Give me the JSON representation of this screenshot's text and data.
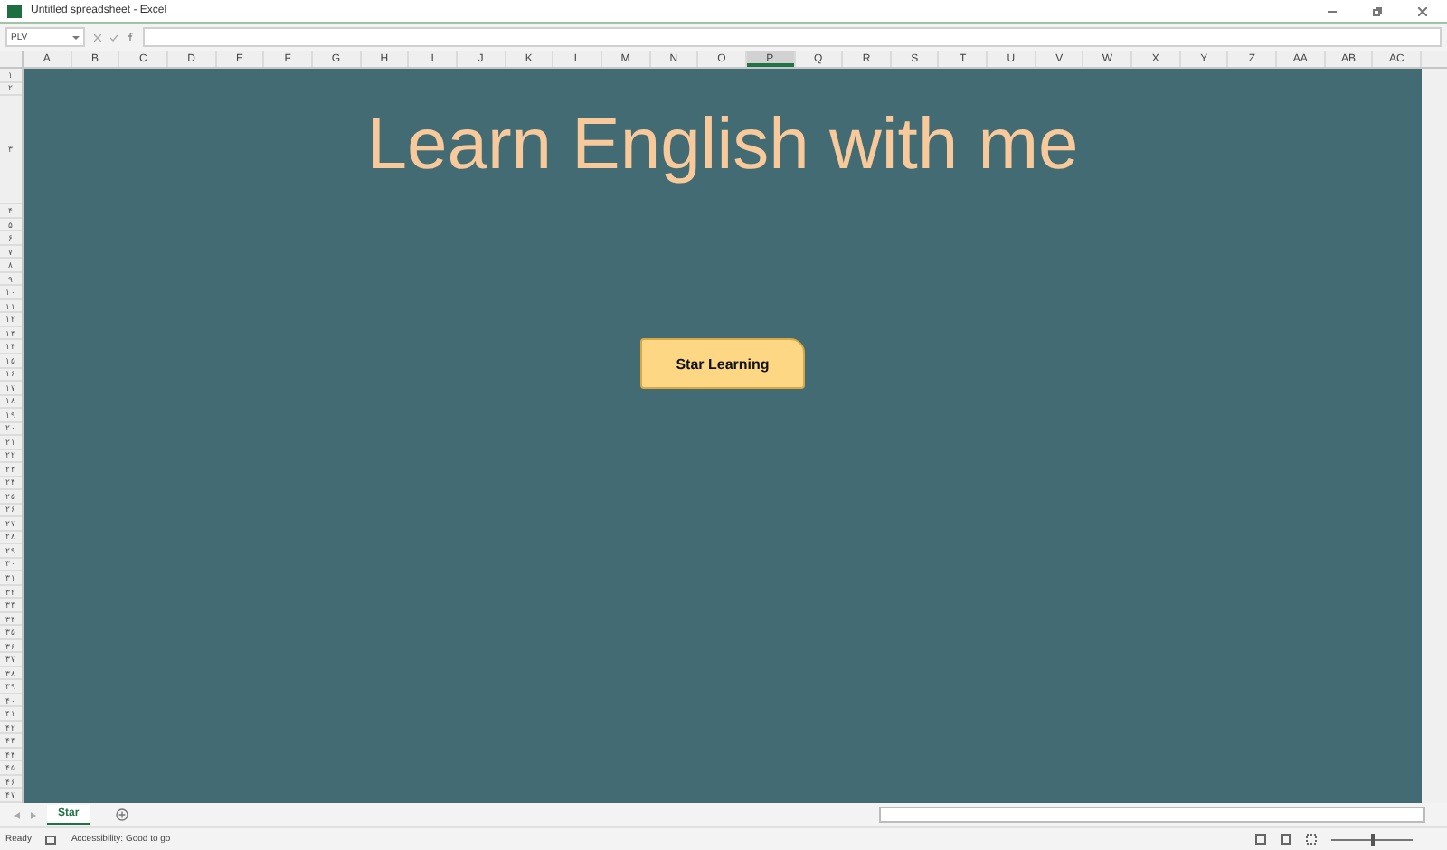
{
  "window": {
    "title": "Untitled spreadsheet - Excel"
  },
  "formula_bar": {
    "name_box": "PLV"
  },
  "columns": [
    {
      "label": "A",
      "selected": false
    },
    {
      "label": "B",
      "selected": false
    },
    {
      "label": "C",
      "selected": false
    },
    {
      "label": "D",
      "selected": false
    },
    {
      "label": "E",
      "selected": false
    },
    {
      "label": "F",
      "selected": false
    },
    {
      "label": "G",
      "selected": false
    },
    {
      "label": "H",
      "selected": false
    },
    {
      "label": "I",
      "selected": false
    },
    {
      "label": "J",
      "selected": false
    },
    {
      "label": "K",
      "selected": false
    },
    {
      "label": "L",
      "selected": false
    },
    {
      "label": "M",
      "selected": false
    },
    {
      "label": "N",
      "selected": false
    },
    {
      "label": "O",
      "selected": false
    },
    {
      "label": "P",
      "selected": true
    },
    {
      "label": "Q",
      "selected": false
    },
    {
      "label": "R",
      "selected": false
    },
    {
      "label": "S",
      "selected": false
    },
    {
      "label": "T",
      "selected": false
    },
    {
      "label": "U",
      "selected": false
    },
    {
      "label": "V",
      "selected": false
    },
    {
      "label": "W",
      "selected": false
    },
    {
      "label": "X",
      "selected": false
    },
    {
      "label": "Y",
      "selected": false
    },
    {
      "label": "Z",
      "selected": false
    },
    {
      "label": "AA",
      "selected": false
    },
    {
      "label": "AB",
      "selected": false
    },
    {
      "label": "AC",
      "selected": false
    }
  ],
  "rows": [
    "۱",
    "۲",
    "۳",
    "۴",
    "۵",
    "۶",
    "۷",
    "۸",
    "۹",
    "۱۰",
    "۱۱",
    "۱۲",
    "۱۳",
    "۱۴",
    "۱۵",
    "۱۶",
    "۱۷",
    "۱۸",
    "۱۹",
    "۲۰",
    "۲۱",
    "۲۲",
    "۲۳",
    "۲۴",
    "۲۵",
    "۲۶",
    "۲۷",
    "۲۸",
    "۲۹",
    "۳۰",
    "۳۱",
    "۳۲",
    "۳۳",
    "۳۴",
    "۳۵",
    "۳۶",
    "۳۷",
    "۳۸",
    "۳۹",
    "۴۰",
    "۴۱",
    "۴۲",
    "۴۳",
    "۴۴",
    "۴۵",
    "۴۶",
    "۴۷"
  ],
  "sheet": {
    "heading": "Learn English with me",
    "button": "Star Learning"
  },
  "sheet_tabs": [
    {
      "label": "Star",
      "selected": true
    }
  ],
  "status_bar": {
    "ready": "Ready",
    "accessibility": "Accessibility: Good to go",
    "zoom": {
      "level": 0.5
    }
  }
}
